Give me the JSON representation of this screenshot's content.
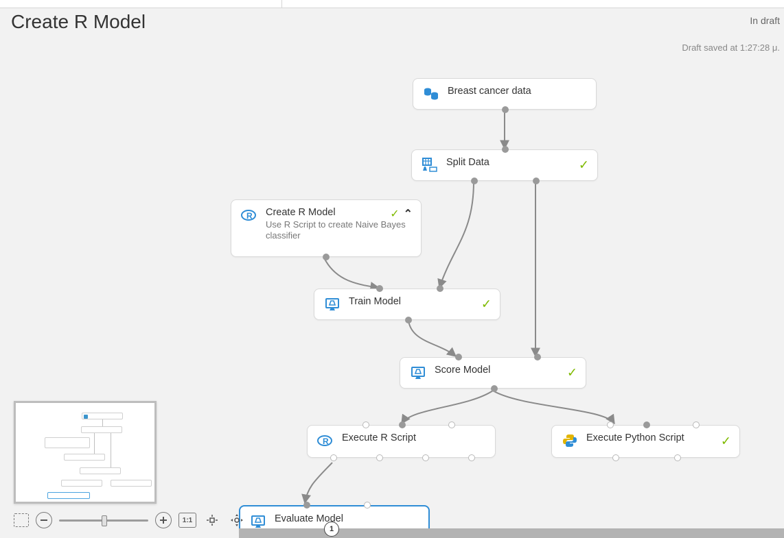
{
  "header": {
    "title": "Create R Model",
    "status": "In draft",
    "saved": "Draft saved at 1:27:28 μ."
  },
  "nodes": {
    "data": {
      "title": "Breast cancer data"
    },
    "split": {
      "title": "Split Data"
    },
    "rmodel": {
      "title": "Create R Model",
      "desc": "Use R Script to create Naive Bayes classifier"
    },
    "train": {
      "title": "Train Model"
    },
    "score": {
      "title": "Score Model"
    },
    "rexec": {
      "title": "Execute R Script"
    },
    "pyexec": {
      "title": "Execute Python Script"
    },
    "eval": {
      "title": "Evaluate Model"
    }
  },
  "toolbar": {
    "actual_size_label": "1:1"
  },
  "page_counter": "1"
}
